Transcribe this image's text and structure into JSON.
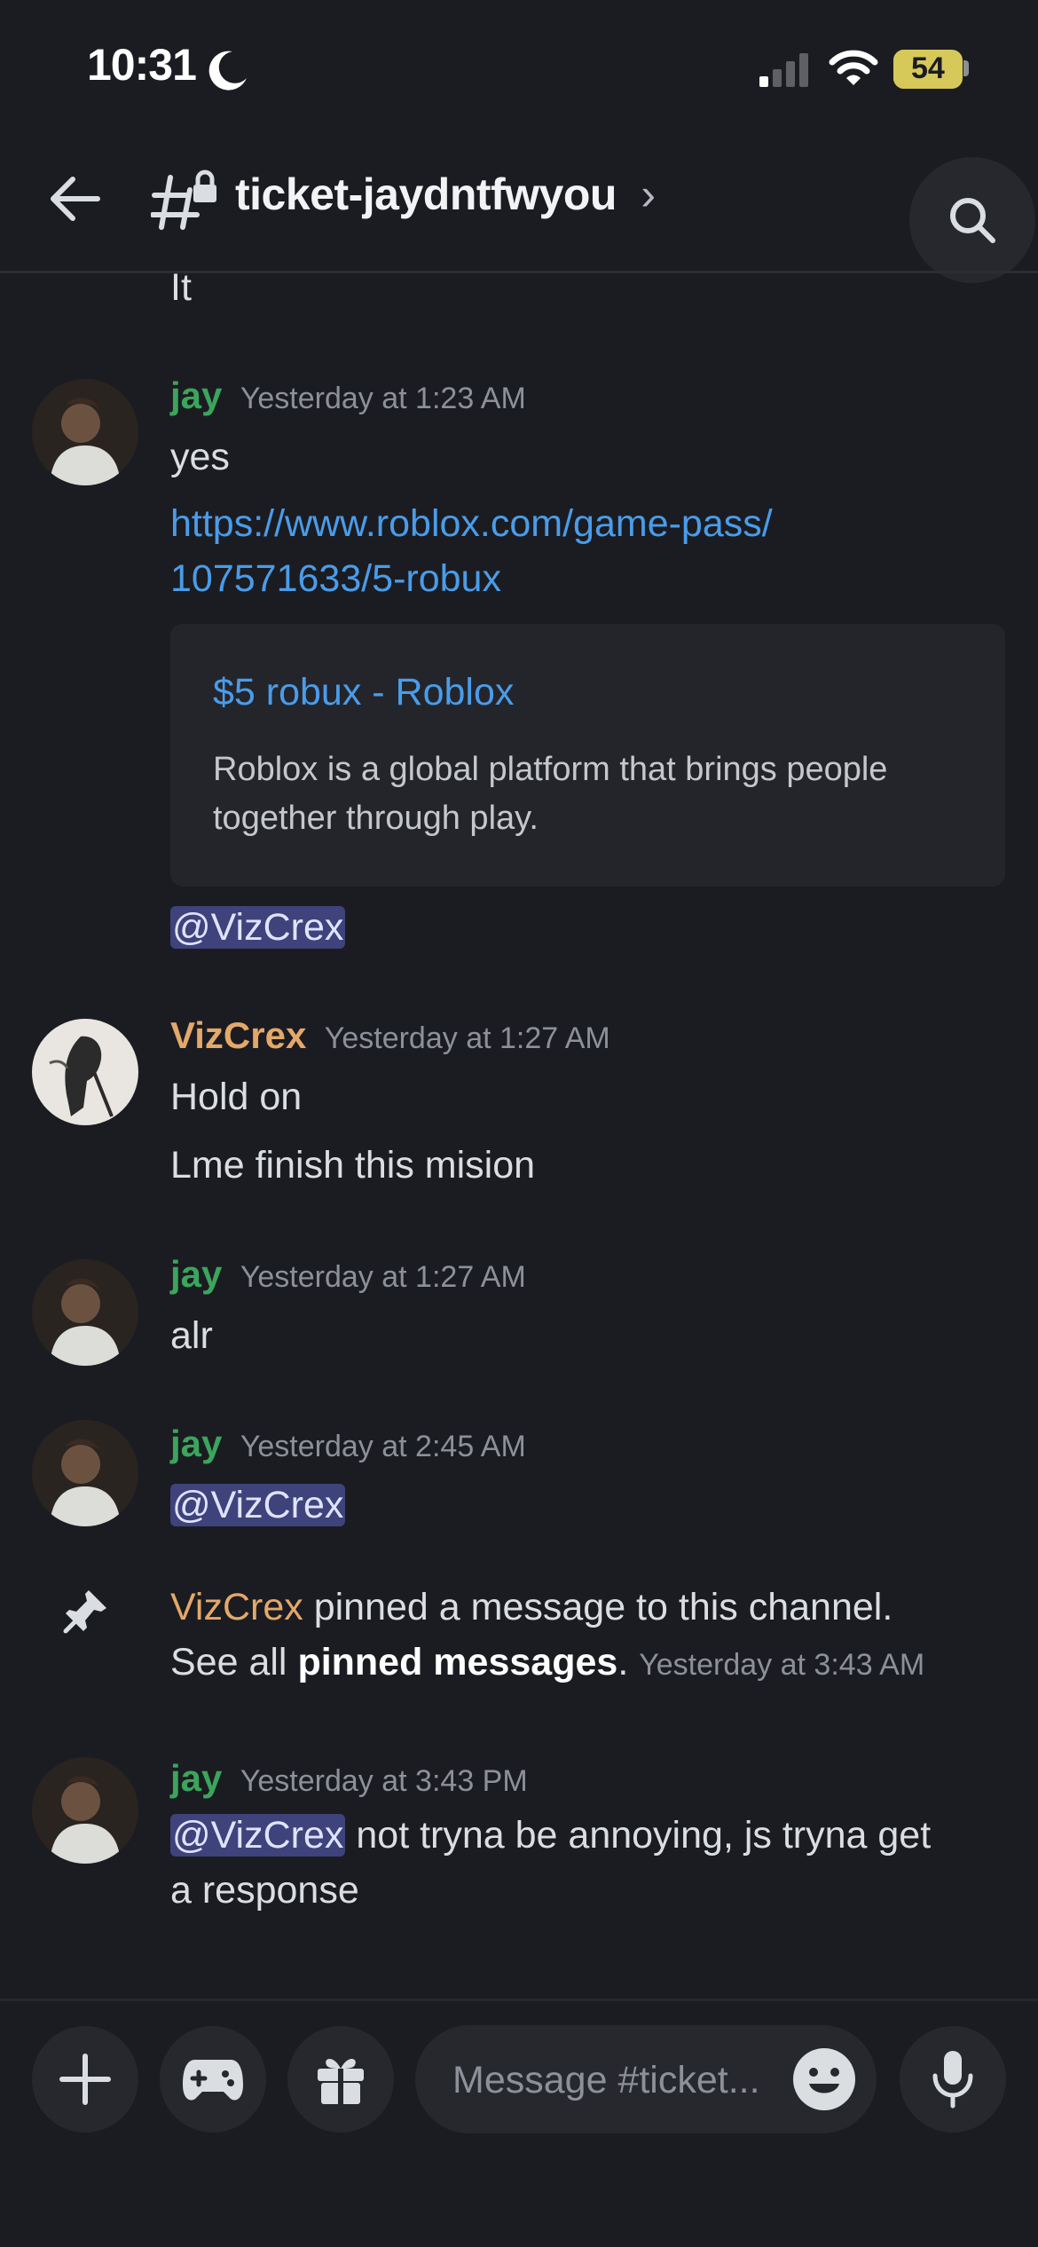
{
  "status_bar": {
    "time": "10:31",
    "battery": "54"
  },
  "header": {
    "channel_name": "ticket-jaydntfwyou",
    "chevron": "›"
  },
  "messages": {
    "top_fragment": "It",
    "m1": {
      "author": "jay",
      "timestamp": "Yesterday at 1:23 AM",
      "line1": "yes",
      "link_line1": "https://www.roblox.com/game-pass/",
      "link_line2": "107571633/5-robux",
      "embed_title": "$5 robux - Roblox",
      "embed_description": "Roblox is a global platform that brings people together through play.",
      "mention": "@VizCrex"
    },
    "m2": {
      "author": "VizCrex",
      "timestamp": "Yesterday at 1:27 AM",
      "line1": "Hold on",
      "line2": "Lme finish this mision"
    },
    "m3": {
      "author": "jay",
      "timestamp": "Yesterday at 1:27 AM",
      "line1": "alr"
    },
    "m4": {
      "author": "jay",
      "timestamp": "Yesterday at 2:45 AM",
      "mention": "@VizCrex"
    },
    "system": {
      "actor": "VizCrex",
      "text1": "pinned a message to this channel.",
      "text2": "See all",
      "pinned_link": "pinned messages",
      "period": ".",
      "timestamp": "Yesterday at 3:43 AM"
    },
    "m5": {
      "author": "jay",
      "timestamp": "Yesterday at 3:43 PM",
      "mention": "@VizCrex",
      "text_after_mention": "not tryna be annoying, js tryna get",
      "line2": "a response"
    }
  },
  "composer": {
    "placeholder": "Message #ticket..."
  },
  "colors": {
    "background": "#1b1c21",
    "jay_name": "#3ba55c",
    "vizcrex_name": "#e3a86a",
    "link": "#4a9ce9",
    "mention_bg": "#3e437b"
  },
  "icons": [
    "moon-icon",
    "signal-icon",
    "wifi-icon",
    "battery-icon",
    "back-arrow-icon",
    "private-channel-icon",
    "search-icon",
    "pin-icon",
    "plus-icon",
    "gamepad-icon",
    "gift-icon",
    "emoji-icon",
    "microphone-icon"
  ]
}
